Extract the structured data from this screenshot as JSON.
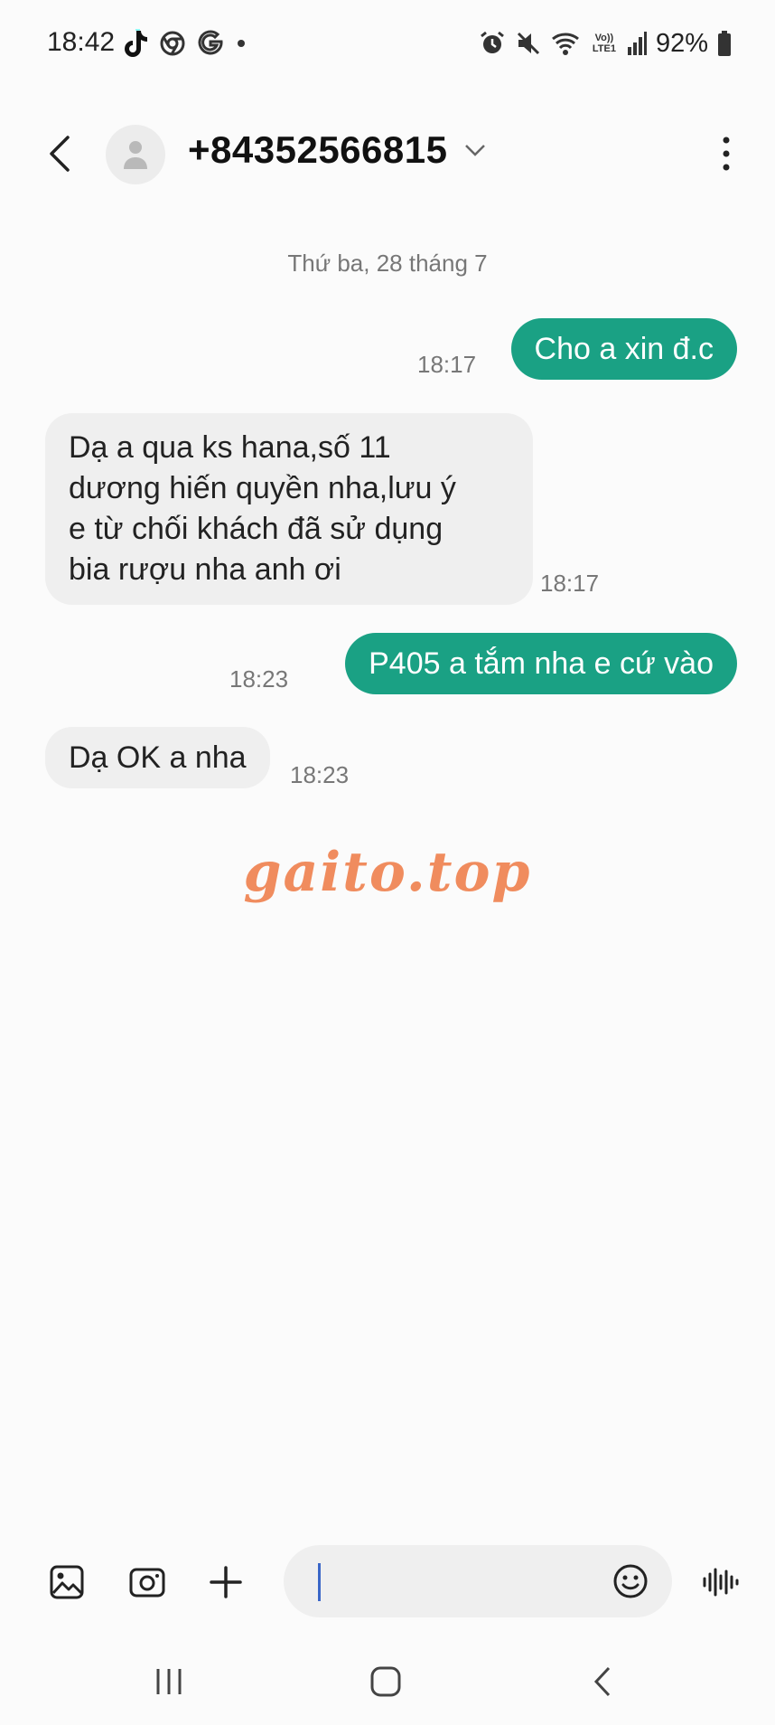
{
  "status_bar": {
    "time": "18:42",
    "battery_percent": "92%",
    "left_icons": [
      "tiktok-icon",
      "chrome-icon",
      "google-icon",
      "dot-icon"
    ],
    "right_icons": [
      "alarm-icon",
      "mute-icon",
      "wifi-calling-icon",
      "volte-lte-icon",
      "signal-icon",
      "battery-icon"
    ],
    "volte_text": "Vo)) LTE1"
  },
  "header": {
    "contact": "+84352566815"
  },
  "conversation": {
    "date_separator": "Thứ ba, 28 tháng 7",
    "messages": [
      {
        "direction": "outgoing",
        "text": "Cho a xin đ.c",
        "time": "18:17"
      },
      {
        "direction": "incoming",
        "lines": [
          "Dạ a qua ks hana,số 11",
          "dương hiến quyền nha,lưu ý",
          "e từ chối khách đã sử dụng",
          "bia rượu nha anh ơi"
        ],
        "time": "18:17"
      },
      {
        "direction": "outgoing",
        "text": "P405 a tắm nha e cứ vào",
        "time": "18:23"
      },
      {
        "direction": "incoming",
        "lines": [
          "Dạ OK a nha"
        ],
        "time": "18:23"
      }
    ]
  },
  "watermark": "gaito.top",
  "composer": {
    "value": ""
  },
  "colors": {
    "outgoing_bubble": "#1aa184",
    "incoming_bubble": "#efefef",
    "background": "#fbfbfb",
    "watermark": "#f08c5e"
  }
}
